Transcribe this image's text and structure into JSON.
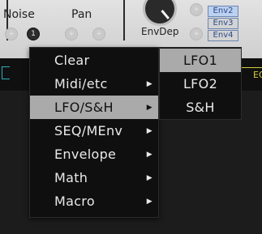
{
  "background": {
    "labels": {
      "noise": "Noise",
      "pan": "Pan",
      "env_dep": "EnvDep"
    },
    "env_tabs": [
      "Env2",
      "Env3",
      "Env4"
    ],
    "strip_text": "EQ"
  },
  "menu": {
    "items": [
      {
        "label": "Clear",
        "has_submenu": false
      },
      {
        "label": "Midi/etc",
        "has_submenu": true,
        "arrow": "▶"
      },
      {
        "label": "LFO/S&H",
        "has_submenu": true,
        "arrow": "▶",
        "selected": true
      },
      {
        "label": "SEQ/MEnv",
        "has_submenu": true,
        "arrow": "▶"
      },
      {
        "label": "Envelope",
        "has_submenu": true,
        "arrow": "▶"
      },
      {
        "label": "Math",
        "has_submenu": true,
        "arrow": "▶"
      },
      {
        "label": "Macro",
        "has_submenu": true,
        "arrow": "▶"
      }
    ]
  },
  "submenu": {
    "items": [
      {
        "label": "LFO1",
        "selected": true
      },
      {
        "label": "LFO2"
      },
      {
        "label": "S&H"
      }
    ]
  },
  "colors": {
    "menu_bg": "#0f0f0f",
    "highlight": "#aaaaaa",
    "text": "#e9e9e9"
  }
}
